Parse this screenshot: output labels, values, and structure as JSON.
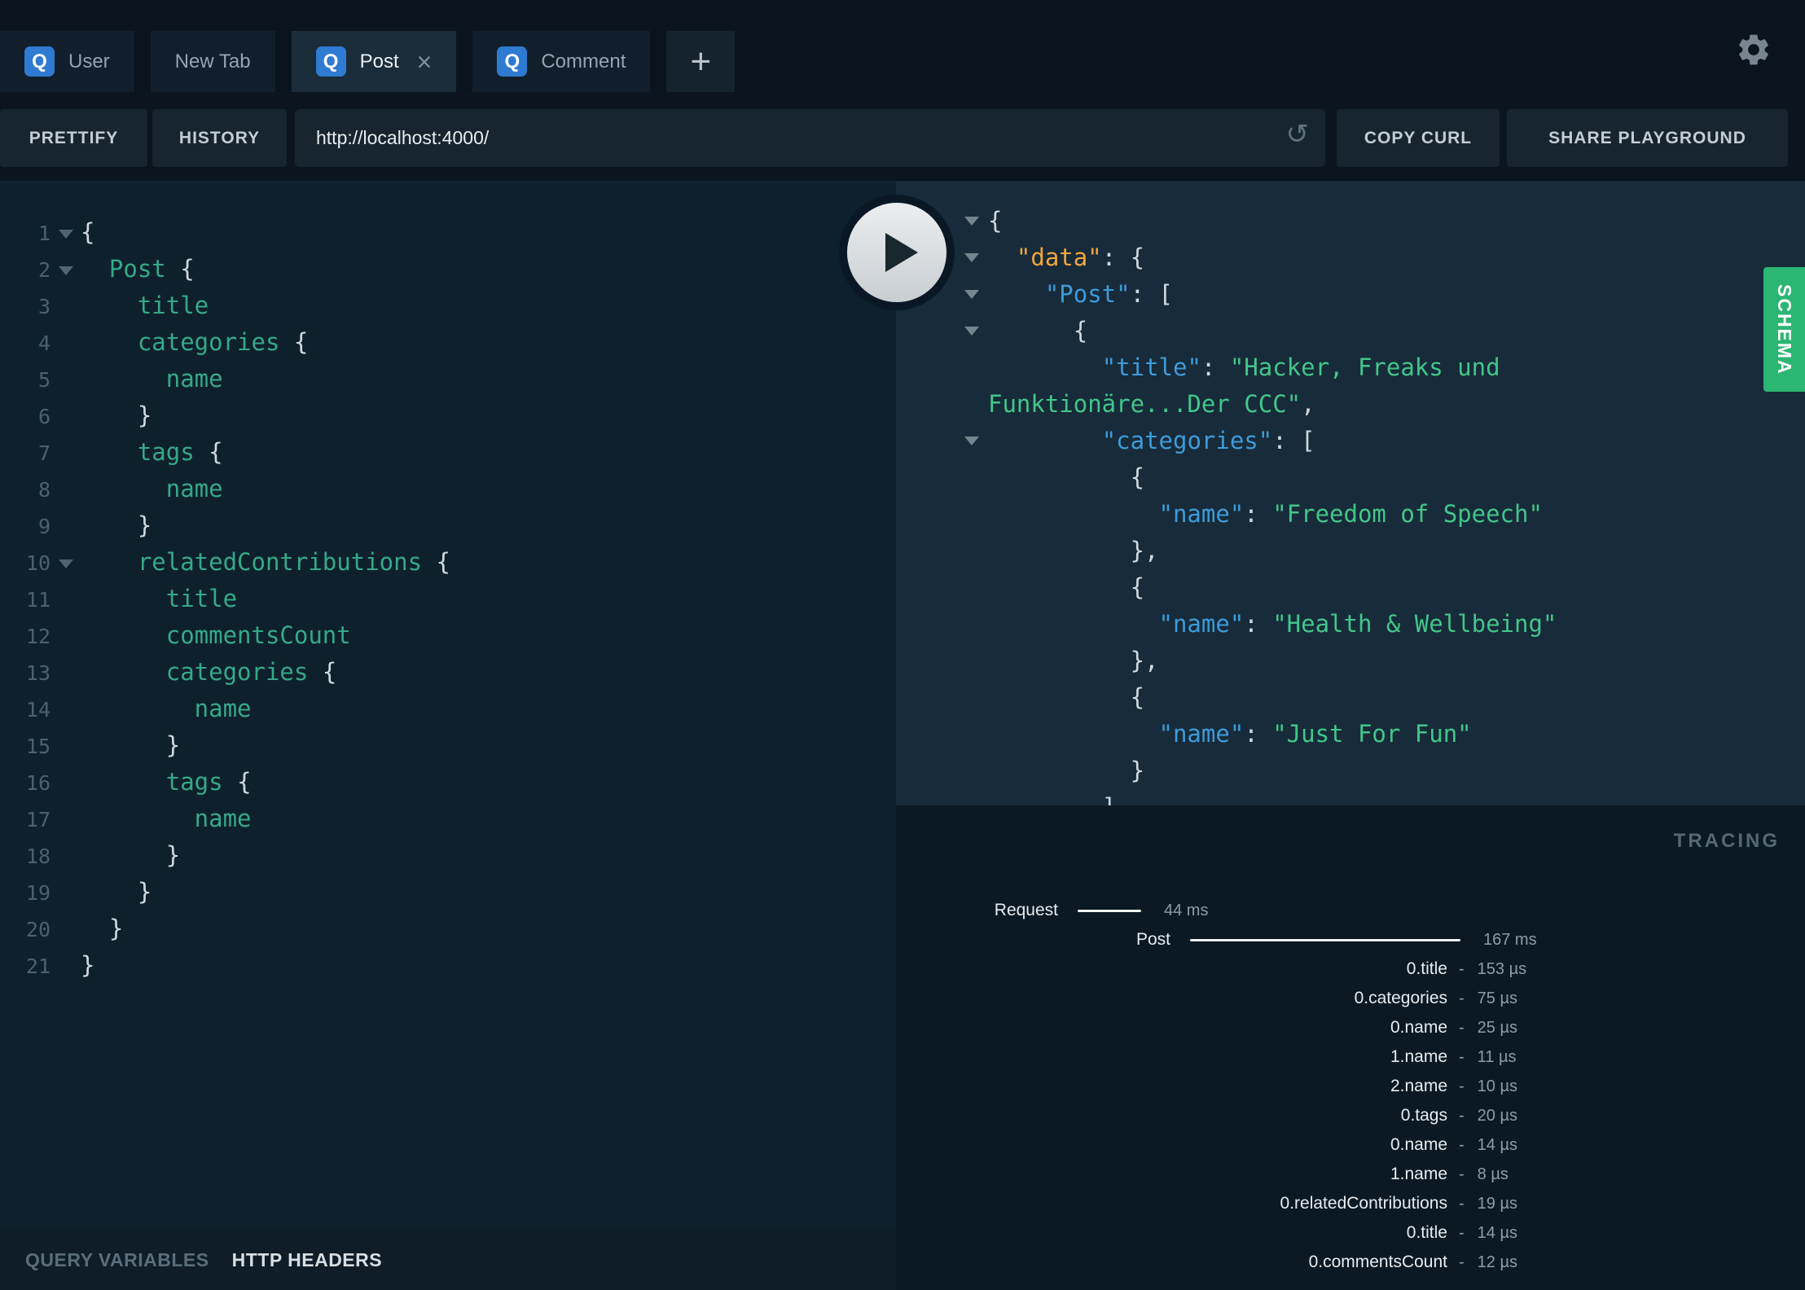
{
  "tabs": {
    "items": [
      {
        "label": "User",
        "icon": "Q",
        "active": false,
        "closable": false
      },
      {
        "label": "New Tab",
        "icon": "",
        "active": false,
        "closable": false
      },
      {
        "label": "Post",
        "icon": "Q",
        "active": true,
        "closable": true
      },
      {
        "label": "Comment",
        "icon": "Q",
        "active": false,
        "closable": false
      }
    ],
    "new_tab_button": "+",
    "close_symbol": "×"
  },
  "toolbar": {
    "prettify": "PRETTIFY",
    "history": "HISTORY",
    "url": "http://localhost:4000/",
    "reload_icon": "↺",
    "copy_curl": "COPY CURL",
    "share_playground": "SHARE PLAYGROUND"
  },
  "editor": {
    "lines": [
      {
        "n": 1,
        "fold": true,
        "seg": [
          [
            "p",
            "{"
          ]
        ]
      },
      {
        "n": 2,
        "fold": true,
        "seg": [
          [
            "kw",
            "  Post"
          ],
          [
            "p",
            " {"
          ]
        ]
      },
      {
        "n": 3,
        "fold": false,
        "seg": [
          [
            "kw",
            "    title"
          ]
        ]
      },
      {
        "n": 4,
        "fold": false,
        "seg": [
          [
            "kw",
            "    categories"
          ],
          [
            "p",
            " {"
          ]
        ]
      },
      {
        "n": 5,
        "fold": false,
        "seg": [
          [
            "kw",
            "      name"
          ]
        ]
      },
      {
        "n": 6,
        "fold": false,
        "seg": [
          [
            "p",
            "    }"
          ]
        ]
      },
      {
        "n": 7,
        "fold": false,
        "seg": [
          [
            "kw",
            "    tags"
          ],
          [
            "p",
            " {"
          ]
        ]
      },
      {
        "n": 8,
        "fold": false,
        "seg": [
          [
            "kw",
            "      name"
          ]
        ]
      },
      {
        "n": 9,
        "fold": false,
        "seg": [
          [
            "p",
            "    }"
          ]
        ]
      },
      {
        "n": 10,
        "fold": true,
        "seg": [
          [
            "kw",
            "    relatedContributions"
          ],
          [
            "p",
            " {"
          ]
        ]
      },
      {
        "n": 11,
        "fold": false,
        "seg": [
          [
            "kw",
            "      title"
          ]
        ]
      },
      {
        "n": 12,
        "fold": false,
        "seg": [
          [
            "kw",
            "      commentsCount"
          ]
        ]
      },
      {
        "n": 13,
        "fold": false,
        "seg": [
          [
            "kw",
            "      categories"
          ],
          [
            "p",
            " {"
          ]
        ]
      },
      {
        "n": 14,
        "fold": false,
        "seg": [
          [
            "kw",
            "        name"
          ]
        ]
      },
      {
        "n": 15,
        "fold": false,
        "seg": [
          [
            "p",
            "      }"
          ]
        ]
      },
      {
        "n": 16,
        "fold": false,
        "seg": [
          [
            "kw",
            "      tags"
          ],
          [
            "p",
            " {"
          ]
        ]
      },
      {
        "n": 17,
        "fold": false,
        "seg": [
          [
            "kw",
            "        name"
          ]
        ]
      },
      {
        "n": 18,
        "fold": false,
        "seg": [
          [
            "p",
            "      }"
          ]
        ]
      },
      {
        "n": 19,
        "fold": false,
        "seg": [
          [
            "p",
            "    }"
          ]
        ]
      },
      {
        "n": 20,
        "fold": false,
        "seg": [
          [
            "p",
            "  }"
          ]
        ]
      },
      {
        "n": 21,
        "fold": false,
        "seg": [
          [
            "p",
            "}"
          ]
        ]
      }
    ]
  },
  "result": {
    "lines": [
      {
        "arrow": true,
        "seg": [
          [
            "p",
            "{"
          ]
        ]
      },
      {
        "arrow": true,
        "seg": [
          [
            "p",
            "  "
          ],
          [
            "root",
            "\"data\""
          ],
          [
            "p",
            ": {"
          ]
        ]
      },
      {
        "arrow": true,
        "seg": [
          [
            "p",
            "    "
          ],
          [
            "key",
            "\"Post\""
          ],
          [
            "p",
            ": ["
          ]
        ]
      },
      {
        "arrow": true,
        "seg": [
          [
            "p",
            "      {"
          ]
        ]
      },
      {
        "arrow": false,
        "seg": [
          [
            "p",
            "        "
          ],
          [
            "key",
            "\"title\""
          ],
          [
            "p",
            ": "
          ],
          [
            "str",
            "\"Hacker, Freaks und"
          ]
        ]
      },
      {
        "arrow": false,
        "seg": [
          [
            "str",
            "Funktionäre...Der CCC\""
          ],
          [
            "p",
            ","
          ]
        ]
      },
      {
        "arrow": true,
        "seg": [
          [
            "p",
            "        "
          ],
          [
            "key",
            "\"categories\""
          ],
          [
            "p",
            ": ["
          ]
        ]
      },
      {
        "arrow": false,
        "seg": [
          [
            "p",
            "          {"
          ]
        ]
      },
      {
        "arrow": false,
        "seg": [
          [
            "p",
            "            "
          ],
          [
            "key",
            "\"name\""
          ],
          [
            "p",
            ": "
          ],
          [
            "str",
            "\"Freedom of Speech\""
          ]
        ]
      },
      {
        "arrow": false,
        "seg": [
          [
            "p",
            "          },"
          ]
        ]
      },
      {
        "arrow": false,
        "seg": [
          [
            "p",
            "          {"
          ]
        ]
      },
      {
        "arrow": false,
        "seg": [
          [
            "p",
            "            "
          ],
          [
            "key",
            "\"name\""
          ],
          [
            "p",
            ": "
          ],
          [
            "str",
            "\"Health & Wellbeing\""
          ]
        ]
      },
      {
        "arrow": false,
        "seg": [
          [
            "p",
            "          },"
          ]
        ]
      },
      {
        "arrow": false,
        "seg": [
          [
            "p",
            "          {"
          ]
        ]
      },
      {
        "arrow": false,
        "seg": [
          [
            "p",
            "            "
          ],
          [
            "key",
            "\"name\""
          ],
          [
            "p",
            ": "
          ],
          [
            "str",
            "\"Just For Fun\""
          ]
        ]
      },
      {
        "arrow": false,
        "seg": [
          [
            "p",
            "          }"
          ]
        ]
      },
      {
        "arrow": false,
        "seg": [
          [
            "p",
            "        ]"
          ]
        ]
      }
    ]
  },
  "schema_tab": {
    "label": "SCHEMA"
  },
  "tracing": {
    "title": "TRACING",
    "rows": [
      {
        "type": "request",
        "label": "Request",
        "bar": 78,
        "time": "44 ms"
      },
      {
        "type": "post",
        "label": "Post",
        "bar": 332,
        "time": "167 ms"
      },
      {
        "type": "leaf",
        "label": "0.title",
        "time": "153 µs"
      },
      {
        "type": "leaf",
        "label": "0.categories",
        "time": "75 µs"
      },
      {
        "type": "leaf",
        "label": "0.name",
        "time": "25 µs"
      },
      {
        "type": "leaf",
        "label": "1.name",
        "time": "11 µs"
      },
      {
        "type": "leaf",
        "label": "2.name",
        "time": "10 µs"
      },
      {
        "type": "leaf",
        "label": "0.tags",
        "time": "20 µs"
      },
      {
        "type": "leaf",
        "label": "0.name",
        "time": "14 µs"
      },
      {
        "type": "leaf",
        "label": "1.name",
        "time": "8 µs"
      },
      {
        "type": "leaf",
        "label": "0.relatedContributions",
        "time": "19 µs"
      },
      {
        "type": "leaf",
        "label": "0.title",
        "time": "14 µs"
      },
      {
        "type": "leaf",
        "label": "0.commentsCount",
        "time": "12 µs"
      }
    ]
  },
  "footer": {
    "query_variables": "QUERY VARIABLES",
    "http_headers": "HTTP HEADERS"
  },
  "colors": {
    "tab_icon_blue": "#2e7bd1",
    "schema_green": "#2bb673",
    "editor_field_green": "#35a987",
    "result_key_blue": "#3e9bd9",
    "result_root_orange": "#f3a73c",
    "result_string_green": "#42c689"
  }
}
